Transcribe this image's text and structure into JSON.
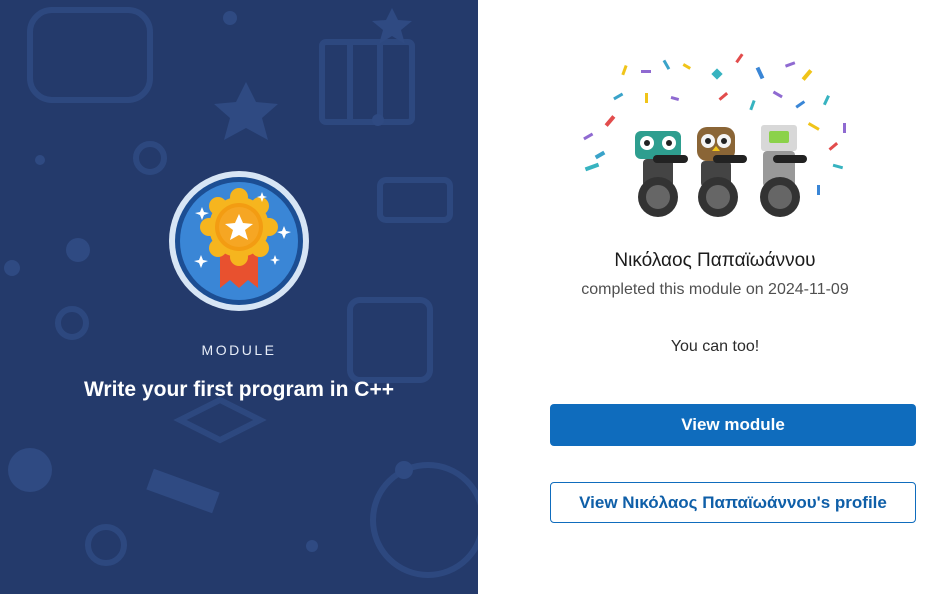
{
  "module_panel": {
    "kicker": "MODULE",
    "title": "Write your first program in C++",
    "badge_icon": "award-medal-icon"
  },
  "achievement": {
    "learner_name": "Νικόλαος Παπαϊωάννου",
    "completion_text": "completed this module on 2024-11-09",
    "encouragement": "You can too!",
    "illustration": "celebrating-robots-illustration"
  },
  "actions": {
    "view_module_label": "View module",
    "view_profile_label": "View Νικόλαος Παπαϊωάννου's profile"
  },
  "colors": {
    "panel_background": "#243a6b",
    "primary_button": "#0f6cbd",
    "badge_ring": "#3a86d6",
    "medal_gold": "#f6b51e",
    "ribbon_red": "#e8512f"
  }
}
